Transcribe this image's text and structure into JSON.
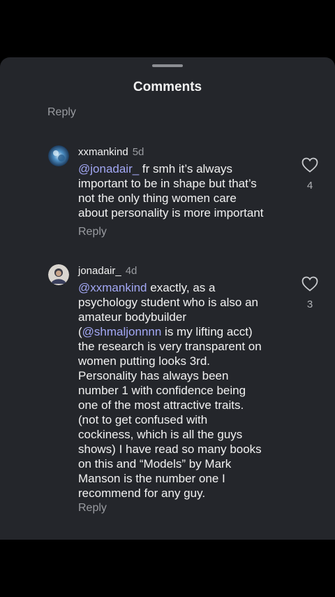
{
  "sheet": {
    "title": "Comments",
    "reply_label": "Reply"
  },
  "comments": [
    {
      "username": "xxmankind",
      "time": "5d",
      "mention": "@jonadair_",
      "text": " fr smh it’s always\nimportant to be in shape but that’s\nnot the only thing women care\nabout personality is more important",
      "likes": "4",
      "reply_label": "Reply"
    },
    {
      "username": "jonadair_",
      "time": "4d",
      "mention": "@xxmankind",
      "text_1": " exactly, as a\npsychology student who is also an\namateur bodybuilder\n(",
      "mention_2": "@shmaljonnnn",
      "text_2": " is my lifting acct)\nthe research is very transparent on\nwomen putting looks 3rd.\nPersonality has always been\nnumber 1 with confidence being\none of the most attractive traits.\n(not to get confused with\ncockiness, which is all the guys\nshows) I have read so many books\non this and “Models” by Mark\nManson is the number one I\nrecommend for any guy.",
      "likes": "3",
      "reply_label": "Reply"
    }
  ]
}
